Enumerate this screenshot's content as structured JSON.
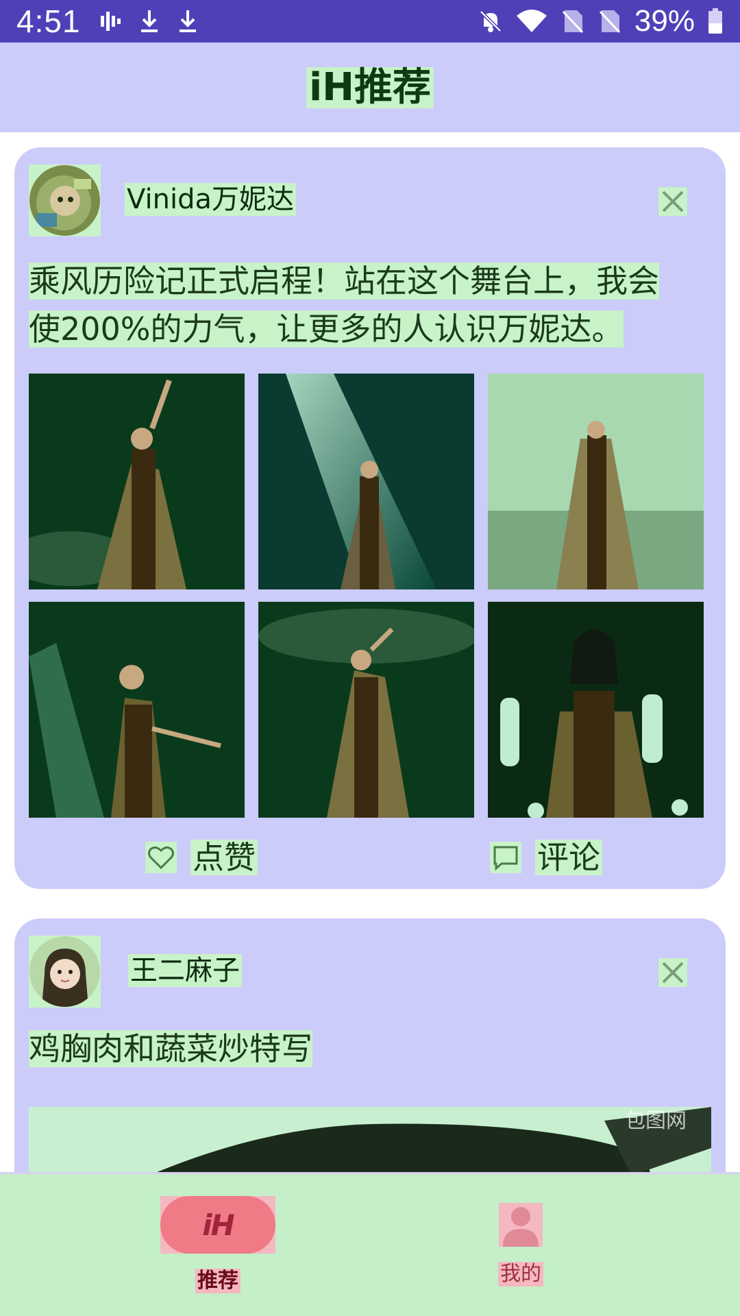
{
  "status_bar": {
    "time": "4:51",
    "battery_percent": "39%",
    "icons_left": [
      "signal-activity-icon",
      "download-icon",
      "download-icon"
    ],
    "icons_right": [
      "bell-off-icon",
      "wifi-icon",
      "no-sim-icon",
      "no-sim-icon",
      "battery-icon"
    ]
  },
  "app_bar": {
    "title": "iH推荐"
  },
  "feed": {
    "posts": [
      {
        "author": "Vinida万妮达",
        "text_line1": "乘风历险记正式启程！站在这个舞台上，我会",
        "text_line2": "使200%的力气，让更多的人认识万妮达。",
        "photo_count": 6,
        "like_label": "点赞",
        "comment_label": "评论"
      },
      {
        "author": "王二麻子",
        "text_line1": "鸡胸肉和蔬菜炒特写",
        "watermark": "包图网"
      }
    ]
  },
  "bottom_nav": {
    "items": [
      {
        "label": "推荐",
        "logo": "iH",
        "active": true
      },
      {
        "label": "我的",
        "active": false
      }
    ]
  },
  "colors": {
    "status_bar": "#5040b8",
    "app_bar": "#ccccfa",
    "card": "#ccccfa",
    "highlight": "#c8f2c8",
    "bottom_nav": "#c5efc8",
    "accent_pink": "#f07a86"
  }
}
